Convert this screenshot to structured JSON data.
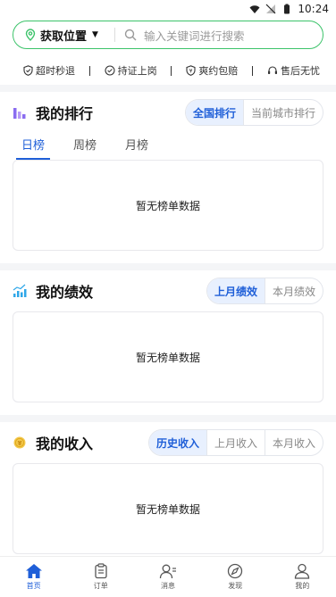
{
  "status": {
    "time": "10:24"
  },
  "location": {
    "label": "获取位置"
  },
  "search": {
    "placeholder": "输入关键词进行搜索"
  },
  "guarantees": [
    "超时秒退",
    "持证上岗",
    "爽约包赔",
    "售后无忧"
  ],
  "ranking": {
    "title": "我的排行",
    "segments": [
      "全国排行",
      "当前城市排行"
    ],
    "tabs": [
      "日榜",
      "周榜",
      "月榜"
    ],
    "empty": "暂无榜单数据"
  },
  "performance": {
    "title": "我的绩效",
    "segments": [
      "上月绩效",
      "本月绩效"
    ],
    "empty": "暂无榜单数据"
  },
  "income": {
    "title": "我的收入",
    "segments": [
      "历史收入",
      "上月收入",
      "本月收入"
    ],
    "empty": "暂无榜单数据"
  },
  "tabbar": [
    "首页",
    "订单",
    "消息",
    "发现",
    "我的"
  ],
  "colors": {
    "accent": "#1f5fd8",
    "green": "#3cc36a"
  }
}
